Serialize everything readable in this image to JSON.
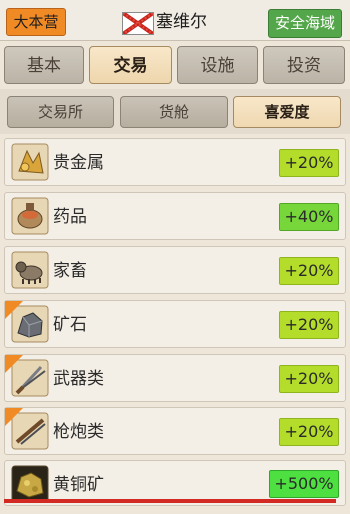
{
  "header": {
    "hq_label": "大本营",
    "city_name": "塞维尔",
    "safe_zone_label": "安全海域"
  },
  "tabs": [
    {
      "label": "基本",
      "active": false
    },
    {
      "label": "交易",
      "active": true
    },
    {
      "label": "设施",
      "active": false
    },
    {
      "label": "投资",
      "active": false
    }
  ],
  "subtabs": [
    {
      "label": "交易所",
      "active": false
    },
    {
      "label": "货舱",
      "active": false
    },
    {
      "label": "喜爱度",
      "active": true
    }
  ],
  "items": [
    {
      "name": "贵金属",
      "bonus": "+20%",
      "icon": "precious-metal-icon",
      "special": false
    },
    {
      "name": "药品",
      "bonus": "+40%",
      "icon": "medicine-icon",
      "special": false
    },
    {
      "name": "家畜",
      "bonus": "+20%",
      "icon": "livestock-icon",
      "special": false
    },
    {
      "name": "矿石",
      "bonus": "+20%",
      "icon": "ore-icon",
      "special": true
    },
    {
      "name": "武器类",
      "bonus": "+20%",
      "icon": "weapons-icon",
      "special": true
    },
    {
      "name": "枪炮类",
      "bonus": "+20%",
      "icon": "firearms-icon",
      "special": true
    },
    {
      "name": "黄铜矿",
      "bonus": "+500%",
      "icon": "chalcopyrite-icon",
      "special": false
    }
  ],
  "colors": {
    "hq": "#f08a24",
    "safe": "#54a64a",
    "bonus": "#b4dc2a",
    "bonus_top": "#4ee040",
    "highlight_line": "#d22a22"
  }
}
